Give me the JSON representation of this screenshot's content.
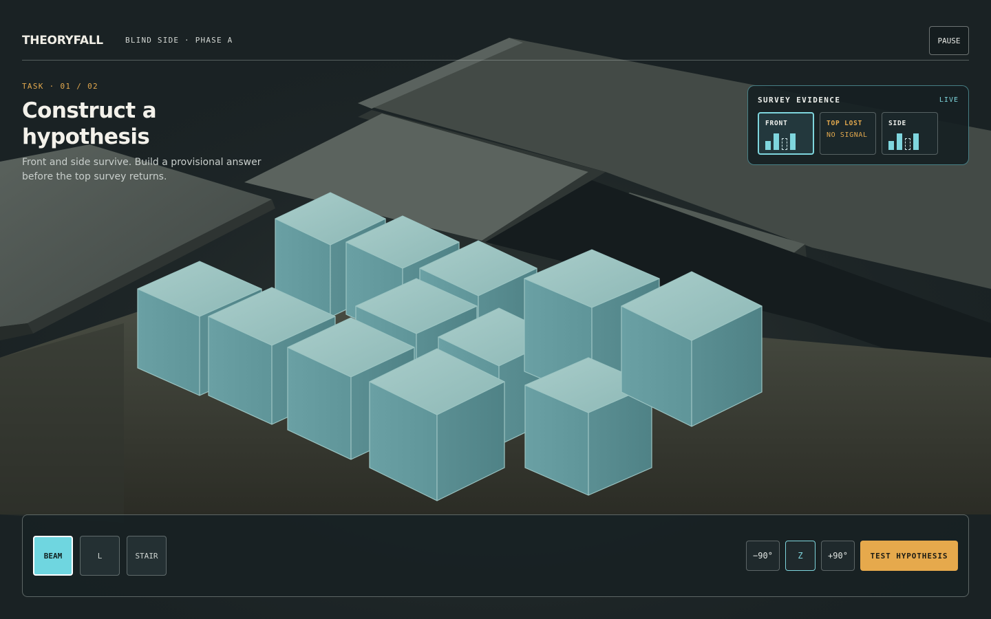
{
  "app": {
    "logo": "THEORYFALL",
    "phase": "BLIND SIDE · PHASE A",
    "pause_label": "PAUSE"
  },
  "task": {
    "label": "TASK · 01 / 02",
    "title": "Construct a hypothesis",
    "description": "Front and side survive. Build a provisional answer before the top survey returns."
  },
  "survey": {
    "title": "SURVEY EVIDENCE",
    "status": "LIVE",
    "cards": [
      {
        "label": "FRONT",
        "active": true
      },
      {
        "label": "TOP LOST",
        "subtext": "NO SIGNAL",
        "active": false
      },
      {
        "label": "SIDE",
        "active": false
      }
    ]
  },
  "pieces": {
    "items": [
      "BEAM",
      "L",
      "STAIR"
    ],
    "selected": "BEAM"
  },
  "rotation": {
    "ccw_label": "−90°",
    "axis_label": "Z",
    "cw_label": "+90°"
  },
  "actions": {
    "test_label": "TEST HYPOTHESIS"
  },
  "colors": {
    "accent": "#6fd6e0",
    "warning": "#e3a94e",
    "block": "#7fb7bb",
    "background": "#1a2224"
  }
}
